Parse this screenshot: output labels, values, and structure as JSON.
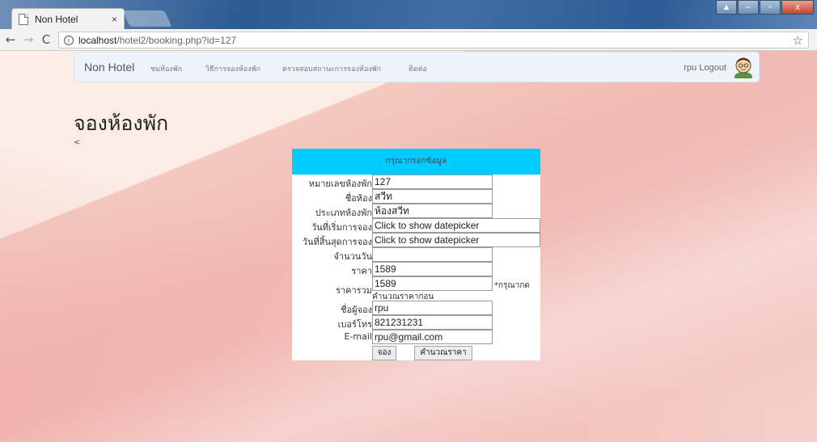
{
  "browser": {
    "tab_title": "Non Hotel",
    "tab_close": "×",
    "url_host": "localhost",
    "url_path": "/hotel2/booking.php?id=127",
    "window_buttons": [
      "▲",
      "–",
      "▫",
      "x"
    ]
  },
  "navbar": {
    "brand": "Non Hotel",
    "links": [
      "ชมห้องพัก",
      "วิธีการจองห้องพัก",
      "ตรวจสอบสถานะการจองห้องพัก",
      "ติดต่อ"
    ],
    "user_logout": "rpu Logout"
  },
  "page": {
    "title": "จองห้องพัก",
    "back_link": "<"
  },
  "form": {
    "header": "กรุณากรอกข้อมูล",
    "fields": {
      "room_number": {
        "label": "หมายเลขห้องพัก",
        "value": "127"
      },
      "room_name": {
        "label": "ชื่อห้อง",
        "value": "สวีท"
      },
      "room_type": {
        "label": "ประเภทห้องพัก",
        "value": "ห้องสวีท"
      },
      "start_date": {
        "label": "วันที่เริ่มการจอง",
        "value": "Click to show datepicker"
      },
      "end_date": {
        "label": "วันที่สิ้นสุดการจอง",
        "value": "Click to show datepicker"
      },
      "days": {
        "label": "จำนวนวัน",
        "value": ""
      },
      "price": {
        "label": "ราคา",
        "value": "1589"
      },
      "total": {
        "label": "ราคารวม",
        "value": "1589",
        "note_right": "*กรุณากด",
        "note_below": "คำนวณราคาก่อน"
      },
      "booker_name": {
        "label": "ชื่อผู้จอง",
        "value": "rpu"
      },
      "phone": {
        "label": "เบอร์โทร",
        "value": "821231231"
      },
      "email": {
        "label": "E-mail",
        "value": "rpu@gmail.com"
      }
    },
    "buttons": {
      "book": "จอง",
      "calculate": "คำนวณราคา"
    }
  },
  "colors": {
    "form_header": "#00ccff",
    "navbar_bg": "#edf3f8"
  },
  "icons": [
    "page-icon",
    "back-arrow-icon",
    "forward-arrow-icon",
    "reload-icon",
    "info-icon",
    "star-icon",
    "menu-icon",
    "avatar-icon"
  ]
}
